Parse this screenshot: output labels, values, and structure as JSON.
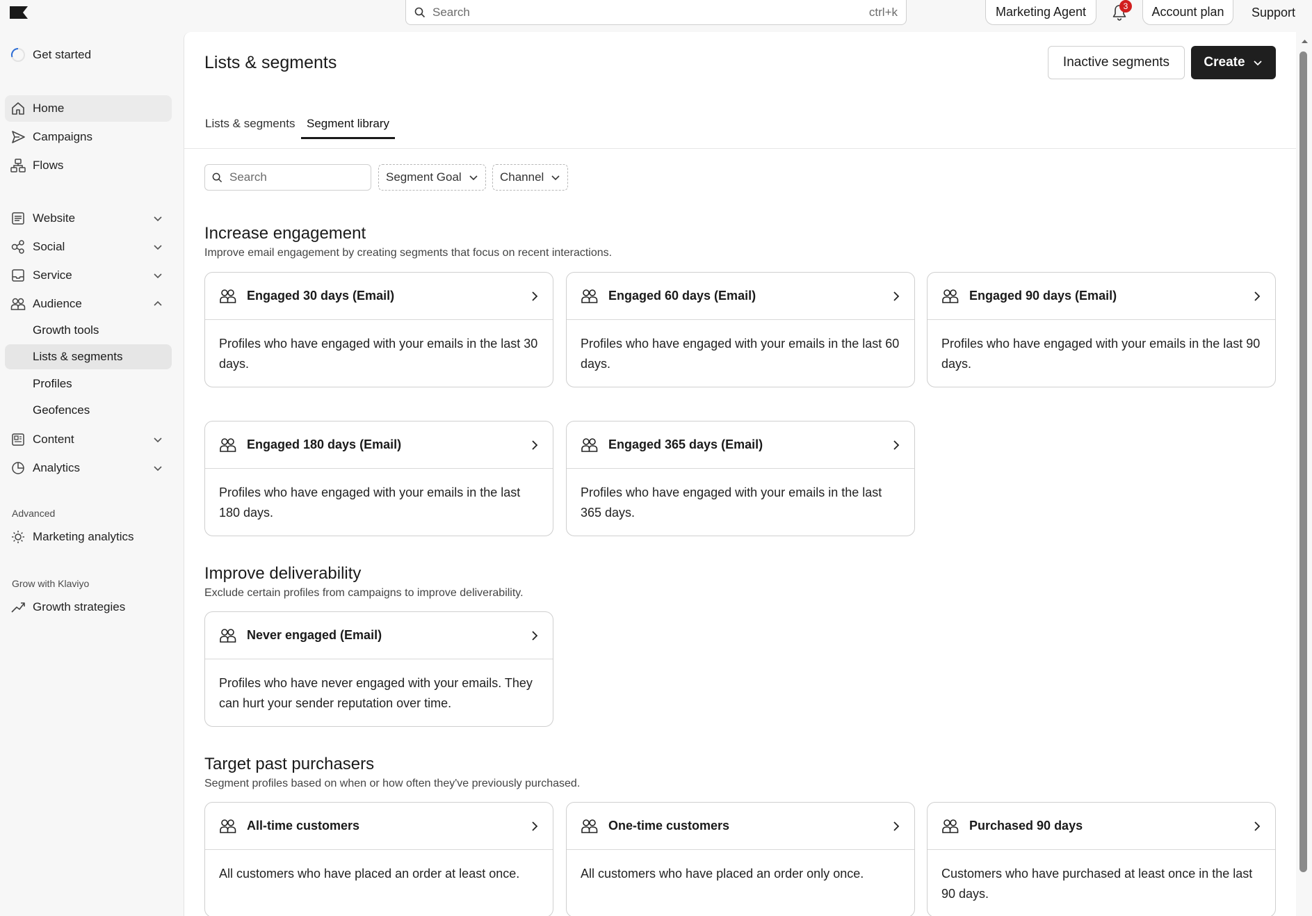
{
  "topbar": {
    "search_placeholder": "Search",
    "search_shortcut": "ctrl+k",
    "marketing_agent": "Marketing Agent",
    "notification_count": "3",
    "account_plan": "Account plan",
    "support": "Support"
  },
  "sidebar": {
    "get_started": "Get started",
    "items": [
      {
        "label": "Home",
        "icon": "home-icon"
      },
      {
        "label": "Campaigns",
        "icon": "send-icon"
      },
      {
        "label": "Flows",
        "icon": "flows-icon"
      },
      {
        "label": "Website",
        "icon": "website-icon"
      },
      {
        "label": "Social",
        "icon": "social-icon"
      },
      {
        "label": "Service",
        "icon": "inbox-icon"
      },
      {
        "label": "Audience",
        "icon": "audience-icon"
      },
      {
        "label": "Content",
        "icon": "content-icon"
      },
      {
        "label": "Analytics",
        "icon": "analytics-icon"
      }
    ],
    "audience_sub": [
      "Growth tools",
      "Lists & segments",
      "Profiles",
      "Geofences"
    ],
    "advanced_label": "Advanced",
    "marketing_analytics": "Marketing analytics",
    "grow_label": "Grow with Klaviyo",
    "growth_strategies": "Growth strategies"
  },
  "main": {
    "title": "Lists & segments",
    "inactive_button": "Inactive segments",
    "create_button": "Create",
    "tabs": [
      "Lists & segments",
      "Segment library"
    ],
    "filter_search_placeholder": "Search",
    "filter_goal": "Segment Goal",
    "filter_channel": "Channel",
    "sections": [
      {
        "title": "Increase engagement",
        "desc": "Improve email engagement by creating segments that focus on recent interactions.",
        "cards": [
          {
            "title": "Engaged 30 days (Email)",
            "body": "Profiles who have engaged with your emails in the last 30 days."
          },
          {
            "title": "Engaged 60 days (Email)",
            "body": "Profiles who have engaged with your emails in the last 60 days."
          },
          {
            "title": "Engaged 90 days (Email)",
            "body": "Profiles who have engaged with your emails in the last 90 days."
          },
          {
            "title": "Engaged 180 days (Email)",
            "body": "Profiles who have engaged with your emails in the last 180 days."
          },
          {
            "title": "Engaged 365 days (Email)",
            "body": "Profiles who have engaged with your emails in the last 365 days."
          }
        ]
      },
      {
        "title": "Improve deliverability",
        "desc": "Exclude certain profiles from campaigns to improve deliverability.",
        "cards": [
          {
            "title": "Never engaged (Email)",
            "body": "Profiles who have never engaged with your emails. They can hurt your sender reputation over time."
          }
        ]
      },
      {
        "title": "Target past purchasers",
        "desc": "Segment profiles based on when or how often they've previously purchased.",
        "cards": [
          {
            "title": "All-time customers",
            "body": "All customers who have placed an order at least once."
          },
          {
            "title": "One-time customers",
            "body": "All customers who have placed an order only once."
          },
          {
            "title": "Purchased 90 days",
            "body": "Customers who have purchased at least once in the last 90 days."
          }
        ]
      }
    ]
  },
  "colors": {
    "accent_dark": "#1f1f1f",
    "badge_red": "#d11f1f",
    "sidebar_active": "#e6e6e6"
  }
}
